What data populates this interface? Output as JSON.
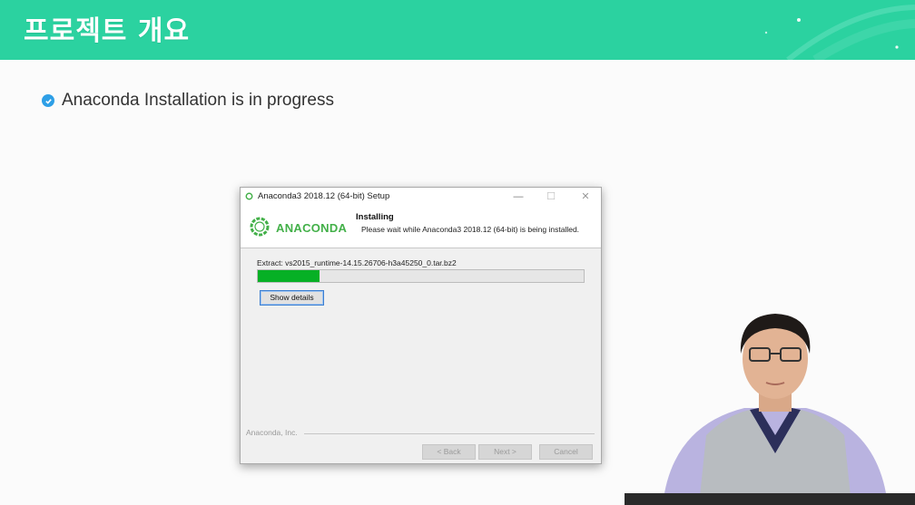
{
  "slide": {
    "title": "프로젝트 개요",
    "bullet": "Anaconda Installation is in progress"
  },
  "installer": {
    "window_title": "Anaconda3 2018.12 (64-bit) Setup",
    "logo_text": "ANACONDA",
    "header_title": "Installing",
    "header_subtitle": "Please wait while Anaconda3 2018.12 (64-bit) is being installed.",
    "extract_label": "Extract: vs2015_runtime-14.15.26706-h3a45250_0.tar.bz2",
    "progress_fraction": 0.19,
    "show_details_label": "Show details",
    "footer_brand": "Anaconda, Inc.",
    "back_label": "< Back",
    "next_label": "Next >",
    "cancel_label": "Cancel",
    "window_controls": [
      "minimize-icon",
      "maximize-icon",
      "close-icon"
    ]
  },
  "colors": {
    "banner": "#2bd2a0",
    "check": "#2e9fe6",
    "progress": "#06b025",
    "anaconda_green": "#43b049"
  }
}
